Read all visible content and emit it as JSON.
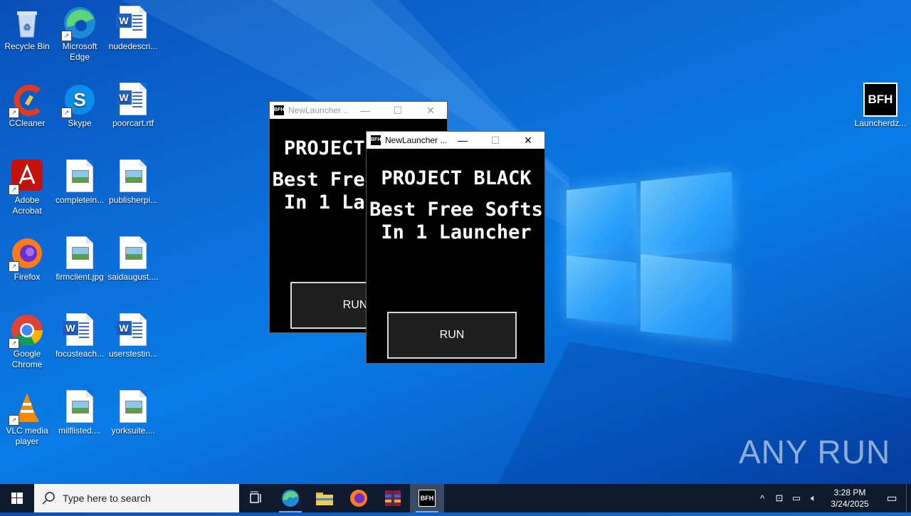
{
  "desktop": {
    "icons": [
      {
        "label": "Recycle Bin"
      },
      {
        "label": "Microsoft Edge"
      },
      {
        "label": "nudedescri..."
      },
      {
        "label": "CCleaner"
      },
      {
        "label": "Skype"
      },
      {
        "label": "poorcart.rtf"
      },
      {
        "label": "Adobe Acrobat"
      },
      {
        "label": "completein..."
      },
      {
        "label": "publisherpi..."
      },
      {
        "label": "Firefox"
      },
      {
        "label": "firmclient.jpg"
      },
      {
        "label": "saidaugust...."
      },
      {
        "label": "Google Chrome"
      },
      {
        "label": "focusteach..."
      },
      {
        "label": "userstestin..."
      },
      {
        "label": "VLC media player"
      },
      {
        "label": "milflisted...."
      },
      {
        "label": "yorksuite...."
      },
      {
        "label": "Launcherdz..."
      }
    ],
    "bfh_icon_text": "BFH",
    "watermark": "ANY RUN"
  },
  "windows": [
    {
      "title": "NewLauncher ...",
      "heading": "PROJECT BLACK",
      "subtitle_line1": "Best Free Softs",
      "subtitle_line2": "In 1 Launcher",
      "button": "RUN",
      "state": "inactive"
    },
    {
      "title": "NewLauncher ...",
      "heading": "PROJECT BLACK",
      "subtitle_line1": "Best Free Softs",
      "subtitle_line2": "In 1 Launcher",
      "button": "RUN",
      "state": "active"
    }
  ],
  "window_controls": {
    "minimize": "—",
    "maximize": "☐",
    "close": "✕"
  },
  "taskbar": {
    "search_placeholder": "Type here to search",
    "time": "3:28 PM",
    "date": "3/24/2025",
    "apps": [
      "task-view",
      "edge",
      "file-explorer",
      "firefox",
      "winrar",
      "bfh-launcher"
    ]
  }
}
